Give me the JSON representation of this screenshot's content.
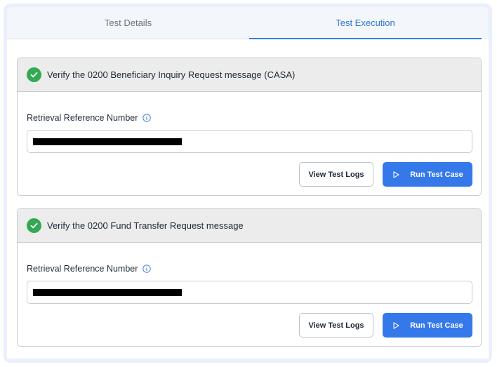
{
  "tabs": [
    {
      "label": "Test Details",
      "active": false
    },
    {
      "label": "Test Execution",
      "active": true
    }
  ],
  "test_cases": [
    {
      "title": "Verify the 0200 Beneficiary Inquiry Request message (CASA)",
      "status": "passed",
      "field_label": "Retrieval Reference Number",
      "field_value": "[redacted]",
      "view_logs_label": "View Test Logs",
      "run_label": "Run Test Case"
    },
    {
      "title": "Verify the 0200 Fund Transfer Request message",
      "status": "passed",
      "field_label": "Retrieval Reference Number",
      "field_value": "[redacted]",
      "view_logs_label": "View Test Logs",
      "run_label": "Run Test Case"
    }
  ],
  "icons": {
    "status": "check-circle-icon",
    "info": "info-icon",
    "run": "play-icon"
  },
  "colors": {
    "accent": "#3478ea",
    "success": "#34a853",
    "tab_active": "#2f74d6"
  }
}
